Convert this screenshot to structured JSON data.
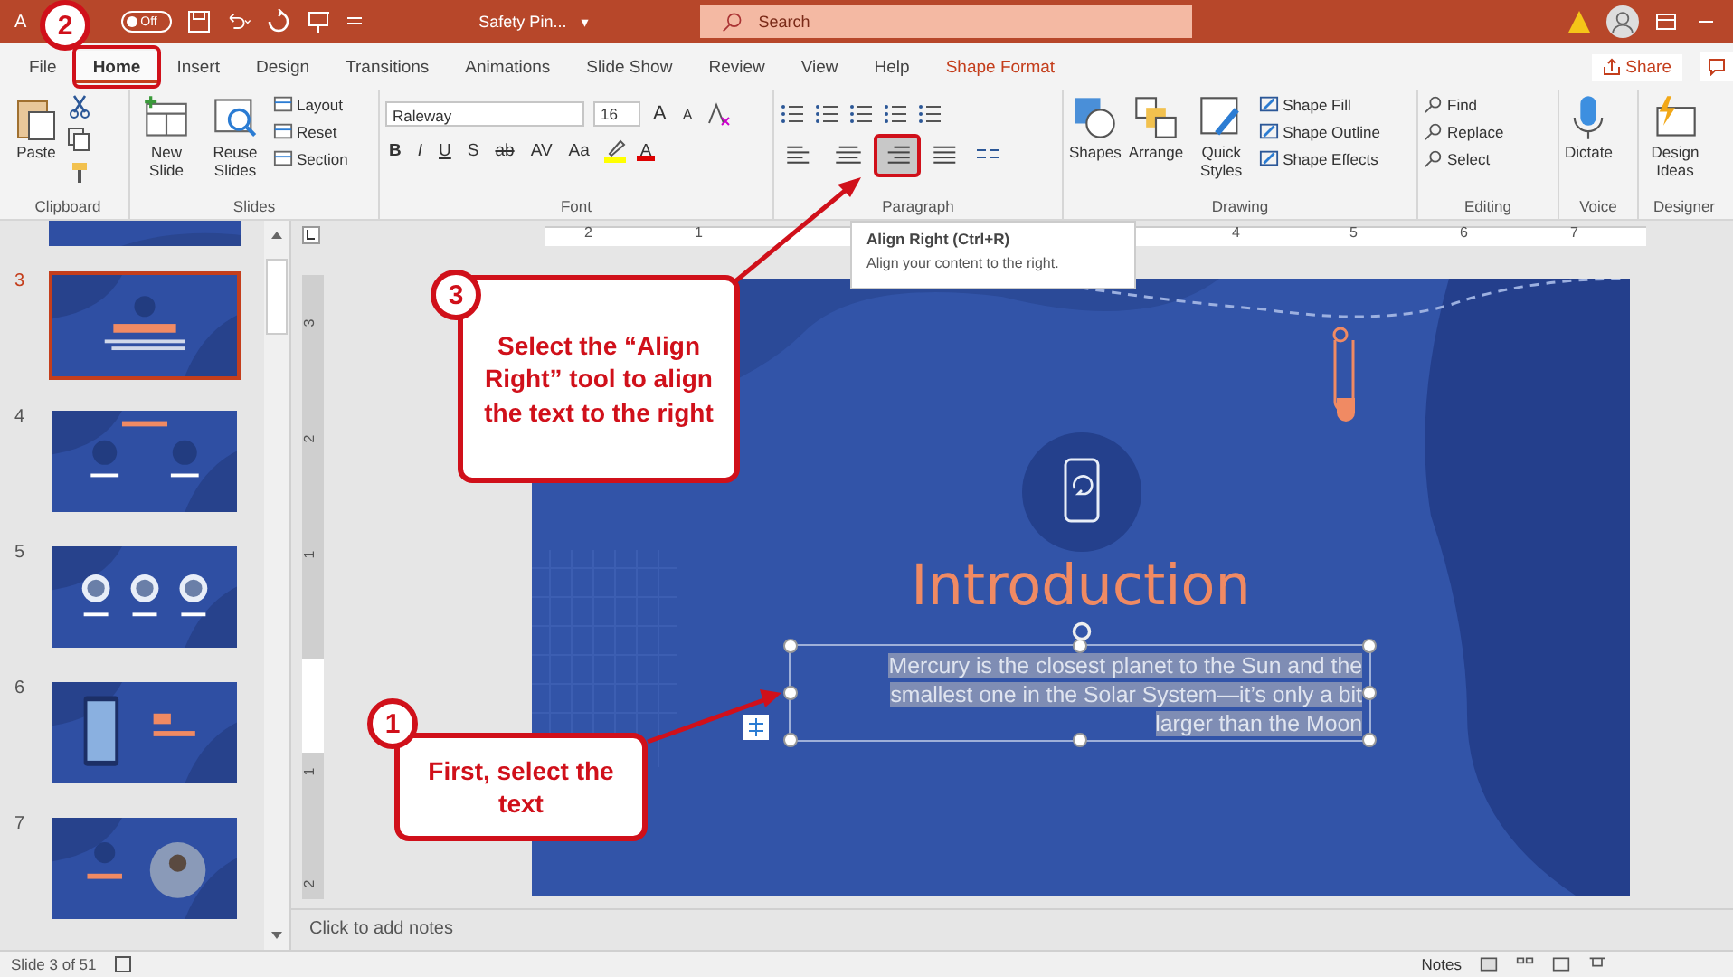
{
  "title_bar": {
    "autosave_label": "A",
    "autosave_toggle": {
      "label": "Off",
      "on": false
    },
    "document_title": "Safety Pin...",
    "title_caret": "▾",
    "search_placeholder": "Search"
  },
  "ribbon_tabs": [
    {
      "label": "File",
      "selected": false,
      "kind": "normal"
    },
    {
      "label": "Home",
      "selected": true,
      "kind": "normal"
    },
    {
      "label": "Insert",
      "selected": false,
      "kind": "normal"
    },
    {
      "label": "Design",
      "selected": false,
      "kind": "normal"
    },
    {
      "label": "Transitions",
      "selected": false,
      "kind": "normal"
    },
    {
      "label": "Animations",
      "selected": false,
      "kind": "normal"
    },
    {
      "label": "Slide Show",
      "selected": false,
      "kind": "normal"
    },
    {
      "label": "Review",
      "selected": false,
      "kind": "normal"
    },
    {
      "label": "View",
      "selected": false,
      "kind": "normal"
    },
    {
      "label": "Help",
      "selected": false,
      "kind": "normal"
    },
    {
      "label": "Shape Format",
      "selected": false,
      "kind": "contextual"
    }
  ],
  "share_button": "Share",
  "ribbon": {
    "clipboard": {
      "label": "Clipboard",
      "paste": "Paste"
    },
    "slides": {
      "label": "Slides",
      "new_slide": "New Slide",
      "reuse_slides": "Reuse Slides",
      "commands": [
        "Layout",
        "Reset",
        "Section"
      ]
    },
    "font": {
      "label": "Font",
      "font_name": "Raleway",
      "font_size": "16",
      "grow": "A",
      "shrink": "A",
      "format_buttons": [
        "B",
        "I",
        "U",
        "S",
        "ab",
        "AV",
        "Aa"
      ],
      "font_color": "A"
    },
    "paragraph": {
      "label": "Paragraph",
      "align_buttons": [
        {
          "kind": "left",
          "selected": false
        },
        {
          "kind": "center",
          "selected": false
        },
        {
          "kind": "right",
          "selected": true
        },
        {
          "kind": "justify",
          "selected": false
        }
      ]
    },
    "drawing": {
      "label": "Drawing",
      "shapes": "Shapes",
      "arrange": "Arrange",
      "quick_styles": "Quick Styles",
      "commands": [
        "Shape Fill",
        "Shape Outline",
        "Shape Effects"
      ]
    },
    "editing": {
      "label": "Editing",
      "commands": [
        "Find",
        "Replace",
        "Select"
      ]
    },
    "voice": {
      "label": "Voice",
      "dictate": "Dictate"
    },
    "designer": {
      "label": "Designer",
      "design_ideas": "Design Ideas"
    }
  },
  "tooltip": {
    "title": "Align Right (Ctrl+R)",
    "description": "Align your content to the right."
  },
  "thumbnails": [
    {
      "number": "3",
      "selected": true
    },
    {
      "number": "4",
      "selected": false
    },
    {
      "number": "5",
      "selected": false
    },
    {
      "number": "6",
      "selected": false
    },
    {
      "number": "7",
      "selected": false
    }
  ],
  "ruler": {
    "horizontal": [
      "2",
      "1",
      "4",
      "5",
      "6",
      "7"
    ],
    "vertical": [
      "3",
      "2",
      "1",
      "1",
      "2"
    ]
  },
  "slide": {
    "title": "Introduction",
    "body_lines": [
      "Mercury is the closest planet to the Sun and the",
      "smallest one in the Solar System—it’s only a bit",
      "larger than the Moon"
    ],
    "body_selected": true
  },
  "notes_placeholder": "Click to add notes",
  "status_bar": {
    "slide_info": "Slide 3 of 51",
    "notes_button": "Notes"
  },
  "callouts": [
    {
      "number": "2"
    },
    {
      "number": "3",
      "text": "Select the “Align Right” tool to align the text to the right"
    },
    {
      "number": "1",
      "text": "First, select the text"
    }
  ]
}
